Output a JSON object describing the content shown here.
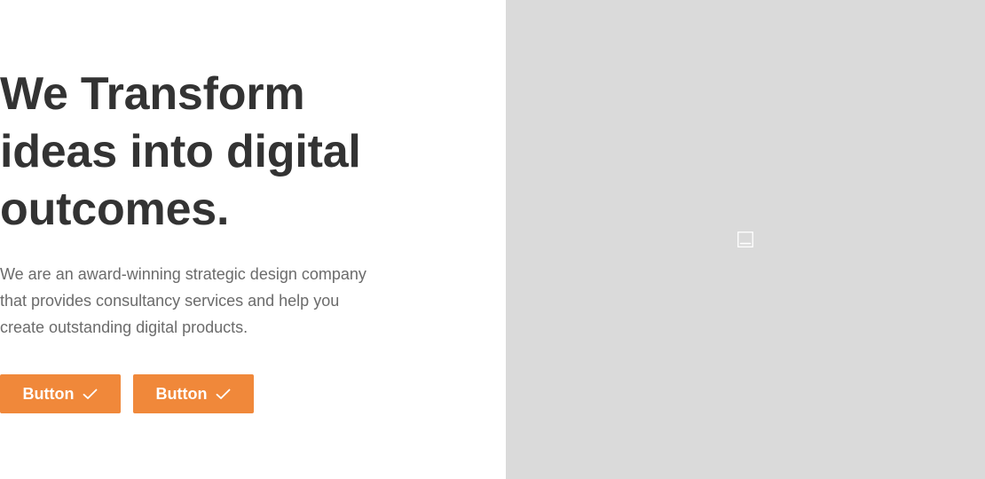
{
  "hero": {
    "headline": [
      "We Transform",
      "ideas into digital",
      "outcomes."
    ],
    "description": [
      "We are an award-winning strategic design company",
      "that provides consultancy services and help you",
      "create outstanding digital products."
    ],
    "buttons": [
      {
        "label": "Button",
        "icon": "check-icon"
      },
      {
        "label": "Button",
        "icon": "check-icon"
      }
    ]
  },
  "media": {
    "icon": "image-placeholder-icon"
  },
  "colors": {
    "accent": "#f0883a",
    "heading": "#333333",
    "body_text": "#6b6b6b",
    "placeholder_bg": "#dadada"
  }
}
